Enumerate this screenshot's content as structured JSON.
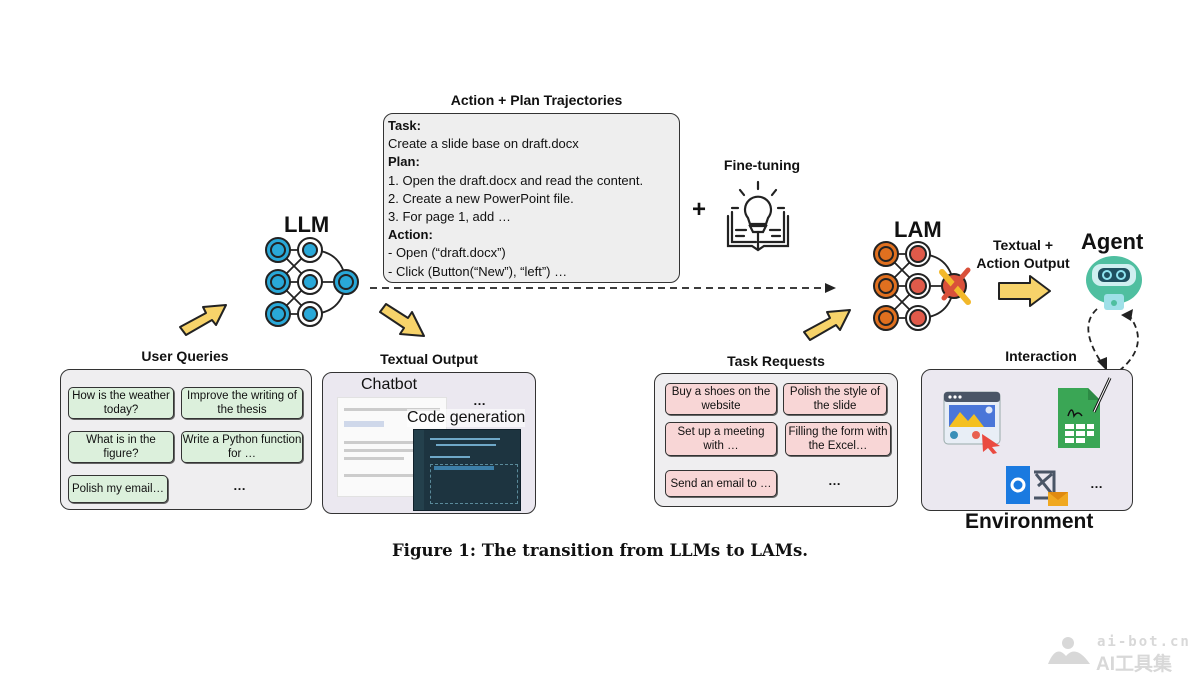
{
  "trajectory": {
    "title": "Action + Plan Trajectories",
    "task_label": "Task:",
    "task_text": "Create a slide base on draft.docx",
    "plan_label": "Plan:",
    "plan_steps": [
      "1. Open the draft.docx and read the content.",
      "2. Create a new PowerPoint file.",
      "3. For page 1, add …"
    ],
    "action_label": "Action:",
    "actions": [
      "- Open (“draft.docx”)",
      "- Click (Button(“New”), “left”) …"
    ]
  },
  "plus_sign": "+",
  "fine_tuning": {
    "label": "Fine-tuning",
    "icon": "lightbulb-book-icon"
  },
  "llm": {
    "label": "LLM",
    "icon": "neural-network-icon",
    "color": "#29a8d8"
  },
  "lam": {
    "label": "LAM",
    "icon": "neural-network-tools-icon",
    "color": "#e0701f"
  },
  "agent": {
    "label": "Agent",
    "icon": "robot-icon",
    "color": "#4fbfa0"
  },
  "textual_action_output": {
    "line1": "Textual +",
    "line2": "Action Output"
  },
  "user_queries": {
    "title": "User Queries",
    "items": [
      "How is the weather today?",
      "Improve the writing of the thesis",
      "What is in the figure?",
      "Write a Python function for …",
      "Polish my email…"
    ],
    "more": "…"
  },
  "textual_output": {
    "title": "Textual Output",
    "chatbot_label": "Chatbot",
    "code_label": "Code generation",
    "more": "…"
  },
  "task_requests": {
    "title": "Task Requests",
    "items": [
      "Buy a shoes on the website",
      "Polish the style of the slide",
      "Set up a meeting with …",
      "Filling the form with the Excel…",
      "Send an email to …"
    ],
    "more": "…"
  },
  "environment": {
    "title": "Environment",
    "interaction_label": "Interaction",
    "apps": [
      "web-browser-icon",
      "spreadsheet-icon",
      "outlook-icon"
    ],
    "more": "…"
  },
  "caption": "Figure 1: The transition from LLMs to LAMs.",
  "watermark": {
    "line1": "ai-bot.cn",
    "line2": "AI工具集"
  },
  "colors": {
    "arrow_fill": "#f7d36a",
    "query_chip": "#dcf0dc",
    "task_chip": "#f8d6d6",
    "panel": "#efeef0"
  }
}
